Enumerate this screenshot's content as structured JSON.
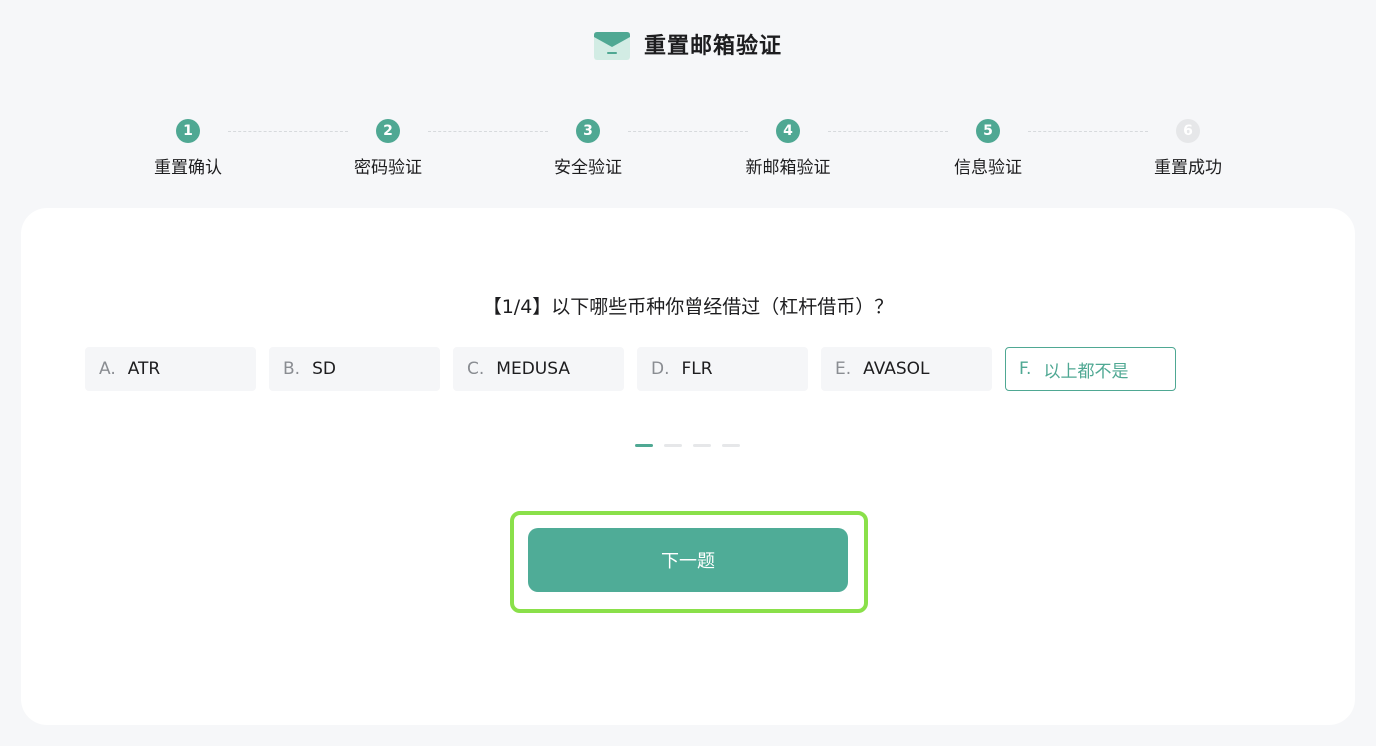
{
  "header": {
    "title": "重置邮箱验证",
    "icon": "mail-icon"
  },
  "steps": [
    {
      "number": "1",
      "label": "重置确认",
      "status": "done"
    },
    {
      "number": "2",
      "label": "密码验证",
      "status": "done"
    },
    {
      "number": "3",
      "label": "安全验证",
      "status": "done"
    },
    {
      "number": "4",
      "label": "新邮箱验证",
      "status": "done"
    },
    {
      "number": "5",
      "label": "信息验证",
      "status": "current"
    },
    {
      "number": "6",
      "label": "重置成功",
      "status": "pending"
    }
  ],
  "question": {
    "text": "【1/4】以下哪些币种你曾经借过（杠杆借币）？"
  },
  "options": [
    {
      "letter": "A.",
      "text": "ATR"
    },
    {
      "letter": "B.",
      "text": "SD"
    },
    {
      "letter": "C.",
      "text": "MEDUSA"
    },
    {
      "letter": "D.",
      "text": "FLR"
    },
    {
      "letter": "E.",
      "text": "AVASOL"
    },
    {
      "letter": "F.",
      "text": "以上都不是"
    }
  ],
  "selected_option": "F.",
  "progress": {
    "current": 1,
    "total": 4
  },
  "next_button": {
    "label": "下一题"
  },
  "colors": {
    "accent": "#4fa893",
    "button": "#4fac97",
    "highlight": "#8ae04a",
    "pending_step": "#e6e7e9"
  }
}
